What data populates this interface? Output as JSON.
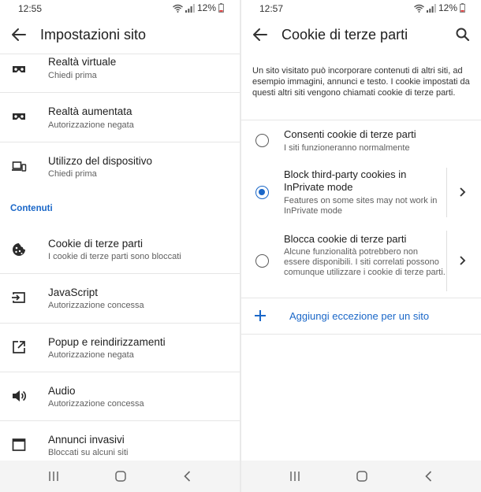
{
  "left": {
    "status": {
      "time": "12:55",
      "battery": "12%"
    },
    "header": {
      "title": "Impostazioni sito"
    },
    "items_top": [
      {
        "title": "Realtà virtuale",
        "subtitle": "Chiedi prima",
        "icon": "vr-headset-icon"
      },
      {
        "title": "Realtà aumentata",
        "subtitle": "Autorizzazione negata",
        "icon": "ar-headset-icon"
      },
      {
        "title": "Utilizzo del dispositivo",
        "subtitle": "Chiedi prima",
        "icon": "devices-icon"
      }
    ],
    "section_label": "Contenuti",
    "items_bottom": [
      {
        "title": "Cookie di terze parti",
        "subtitle": "I cookie di terze parti sono bloccati",
        "icon": "cookie-icon"
      },
      {
        "title": "JavaScript",
        "subtitle": "Autorizzazione concessa",
        "icon": "javascript-icon"
      },
      {
        "title": "Popup e reindirizzamenti",
        "subtitle": "Autorizzazione negata",
        "icon": "popup-icon"
      },
      {
        "title": "Audio",
        "subtitle": "Autorizzazione concessa",
        "icon": "speaker-icon"
      },
      {
        "title": "Annunci invasivi",
        "subtitle": "Bloccati su alcuni siti",
        "icon": "ad-window-icon"
      }
    ]
  },
  "right": {
    "status": {
      "time": "12:57",
      "battery": "12%"
    },
    "header": {
      "title": "Cookie di terze parti"
    },
    "description": "Un sito visitato può incorporare contenuti di altri siti, ad esempio immagini, annunci e testo. I cookie impostati da questi altri siti vengono chiamati cookie di terze parti.",
    "options": [
      {
        "title": "Consenti cookie di terze parti",
        "subtitle": "I siti funzioneranno normalmente",
        "selected": false
      },
      {
        "title": "Block third-party cookies in InPrivate mode",
        "subtitle": "Features on some sites may not work in InPrivate mode",
        "selected": true
      },
      {
        "title": "Blocca cookie di terze parti",
        "subtitle": "Alcune funzionalità potrebbero non essere disponibili. I siti correlati possono comunque utilizzare i cookie di terze parti.",
        "selected": false
      }
    ],
    "add_exception": "Aggiungi eccezione per un sito"
  },
  "colors": {
    "accent": "#1a67c8",
    "text": "#202020",
    "subtext": "#5f5f5f",
    "navbar": "#f4f4f4"
  }
}
